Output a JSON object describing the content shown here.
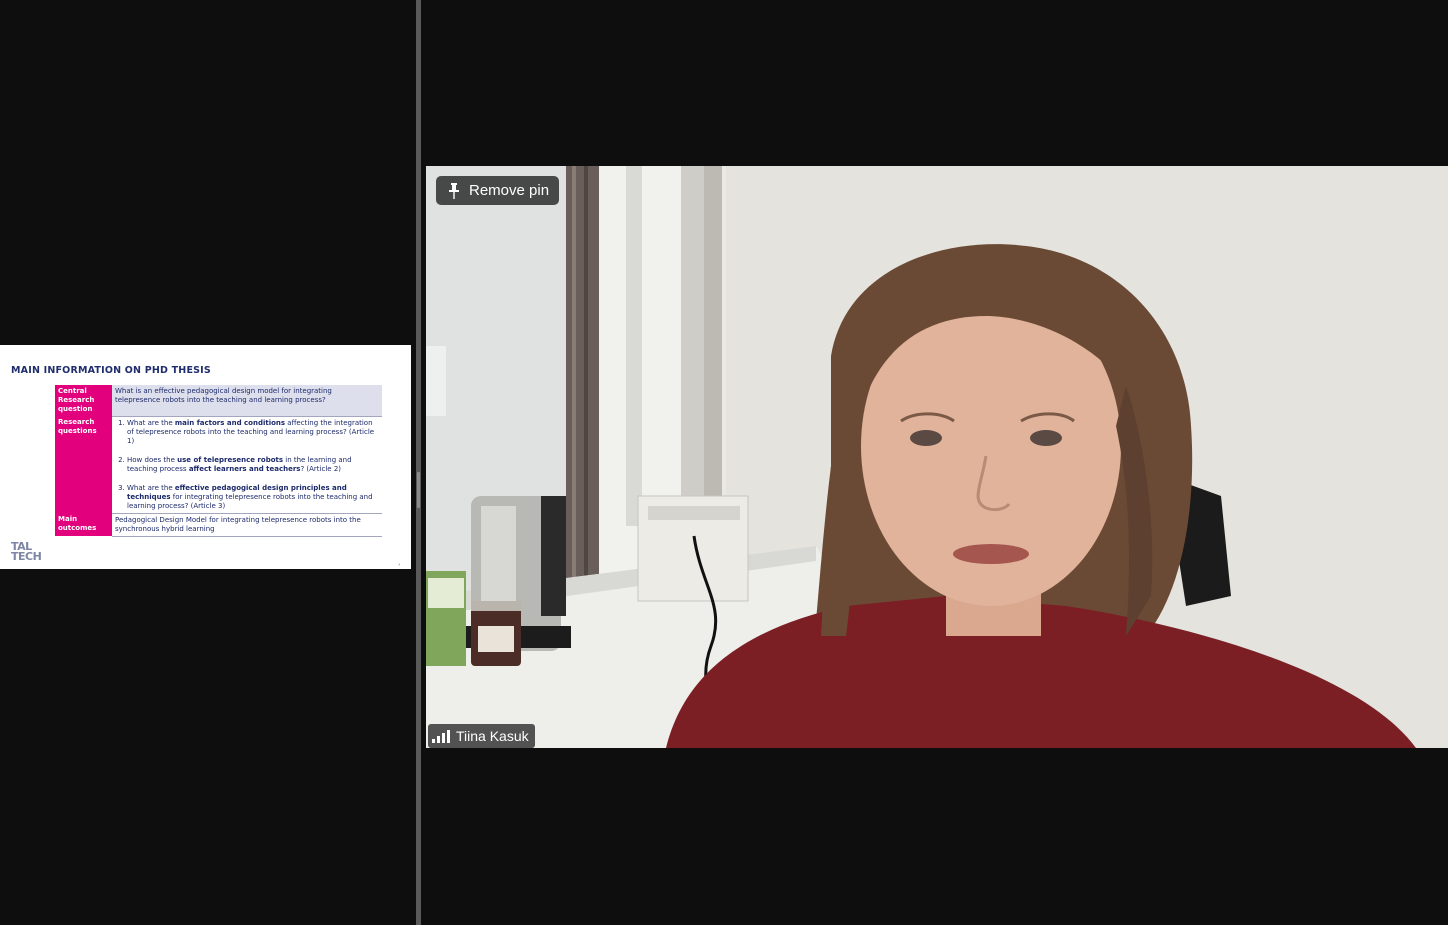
{
  "slide": {
    "title": "MAIN INFORMATION ON PHD THESIS",
    "rows": [
      {
        "header": "Central Research question",
        "text": "What is an effective pedagogical design model for integrating telepresence robots into the teaching and learning process?"
      },
      {
        "header": "Research questions",
        "items": [
          {
            "a": "What are the ",
            "b": "main factors and conditions",
            "c": " affecting the integration of telepresence robots into the teaching and learning process? (Article 1)"
          },
          {
            "a": "How does the ",
            "b": "use of telepresence robots",
            "c": " in the learning and teaching process ",
            "d": "affect learners and teachers",
            "e": "? (Article 2)"
          },
          {
            "a": "What are the ",
            "b": "effective pedagogical design principles and techniques",
            "c": " for integrating telepresence robots into the teaching and learning process? (Article 3)"
          }
        ]
      },
      {
        "header": "Main outcomes",
        "text": "Pedagogical Design Model for integrating telepresence robots into the synchronous hybrid learning"
      }
    ],
    "logo_line1": "TAL",
    "logo_line2": "TECH"
  },
  "video": {
    "pin_label": "Remove pin",
    "participant_name": "Tiina Kasuk"
  },
  "colors": {
    "accent": "#e3007d",
    "navy": "#1f2d6e",
    "background": "#0e0e0e"
  },
  "icons": [
    "pin-icon",
    "signal-strength-icon"
  ]
}
